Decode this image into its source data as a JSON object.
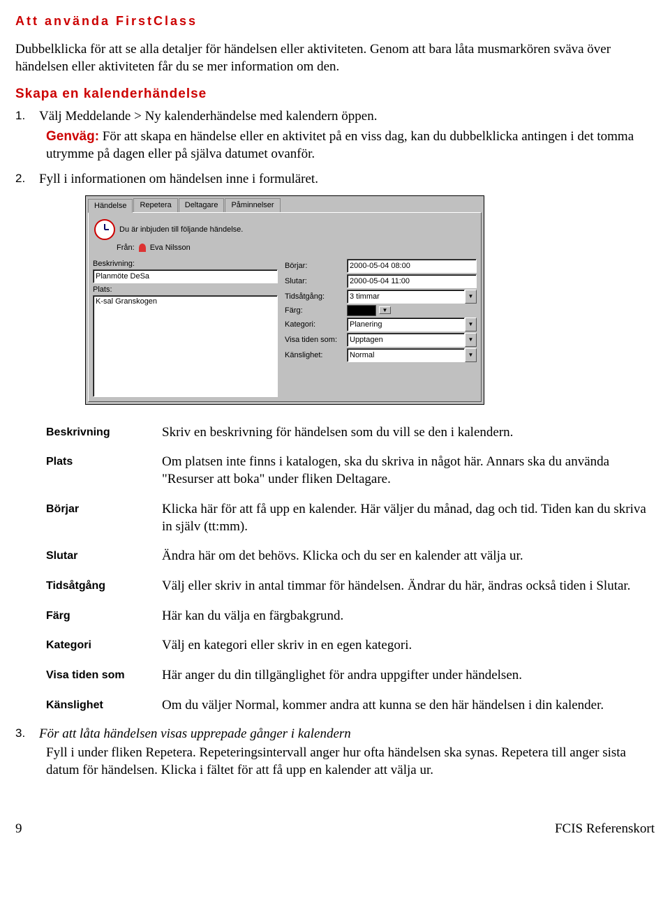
{
  "header": {
    "title": "Att använda FirstClass"
  },
  "intro": "Dubbelklicka för att se alla detaljer för händelsen eller aktiviteten. Genom att bara låta musmarkören sväva över händelsen eller aktiviteten får du se mer information om den.",
  "section_title": "Skapa en kalenderhändelse",
  "step1": {
    "num": "1.",
    "text": "Välj Meddelande > Ny kalenderhändelse med kalendern öppen."
  },
  "genvag": {
    "label": "Genväg:",
    "text": "För att skapa en händelse eller en aktivitet på en viss dag, kan du dubbelklicka antingen i det tomma utrymme på dagen eller på själva datumet ovanför."
  },
  "step2": {
    "num": "2.",
    "text": "Fyll i informationen om händelsen inne i formuläret."
  },
  "dialog": {
    "tabs": [
      "Händelse",
      "Repetera",
      "Deltagare",
      "Påminnelser"
    ],
    "invite_text": "Du är inbjuden till följande händelse.",
    "from_label": "Från:",
    "from_value": "Eva Nilsson",
    "left": {
      "beskrivning_label": "Beskrivning:",
      "beskrivning_value": "Planmöte DeSa",
      "plats_label": "Plats:",
      "plats_value": "K-sal Granskogen"
    },
    "right": {
      "borjar_label": "Börjar:",
      "borjar_value": "2000-05-04 08:00",
      "slutar_label": "Slutar:",
      "slutar_value": "2000-05-04 11:00",
      "tids_label": "Tidsåtgång:",
      "tids_value": "3 timmar",
      "farg_label": "Färg:",
      "kategori_label": "Kategori:",
      "kategori_value": "Planering",
      "visa_label": "Visa tiden som:",
      "visa_value": "Upptagen",
      "kanslighet_label": "Känslighet:",
      "kanslighet_value": "Normal"
    }
  },
  "fields": [
    {
      "term": "Beskrivning",
      "def": "Skriv en beskrivning för händelsen som du vill se den i kalendern."
    },
    {
      "term": "Plats",
      "def": "Om platsen inte finns i katalogen, ska du skriva in något här. Annars ska du använda \"Resurser att boka\" under fliken Deltagare."
    },
    {
      "term": "Börjar",
      "def": "Klicka här för att få upp en kalender. Här väljer du månad, dag och tid. Tiden kan du skriva in själv (tt:mm)."
    },
    {
      "term": "Slutar",
      "def": "Ändra här om det behövs. Klicka och du ser en kalender att välja ur."
    },
    {
      "term": "Tidsåtgång",
      "def": "Välj eller skriv in antal timmar för händelsen. Ändrar du här, ändras också tiden i Slutar."
    },
    {
      "term": "Färg",
      "def": "Här kan du välja en färgbakgrund."
    },
    {
      "term": "Kategori",
      "def": "Välj en kategori eller skriv in en egen kategori."
    },
    {
      "term": "Visa tiden som",
      "def": "Här anger du din tillgänglighet för andra uppgifter under händelsen."
    },
    {
      "term": "Känslighet",
      "def": "Om du väljer Normal, kommer andra att kunna se den här händelsen i din kalender."
    }
  ],
  "step3": {
    "num": "3.",
    "italic": "För att låta händelsen visas upprepade gånger i kalendern",
    "text": "Fyll i under fliken Repetera. Repeteringsintervall anger hur ofta händelsen ska synas. Repetera till anger sista datum för händelsen. Klicka i fältet för att få upp en kalender att välja ur."
  },
  "footer": {
    "page": "9",
    "ref": "FCIS Referenskort"
  }
}
